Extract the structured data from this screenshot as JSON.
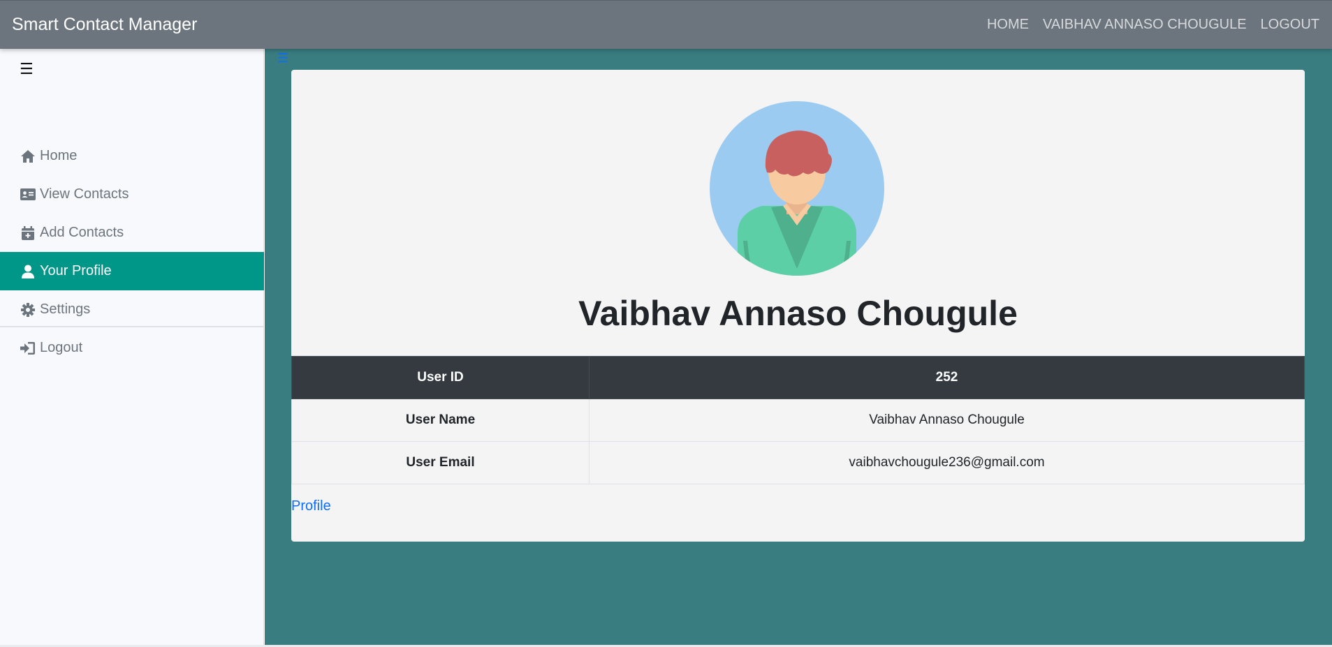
{
  "navbar": {
    "brand": "Smart Contact Manager",
    "links": [
      "HOME",
      "VAIBHAV ANNASO CHOUGULE",
      "LOGOUT"
    ]
  },
  "sidebar": {
    "menu_icon": "hamburger-menu-icon",
    "items": [
      {
        "label": "Home",
        "icon": "home-icon"
      },
      {
        "label": "View Contacts",
        "icon": "address-card-icon"
      },
      {
        "label": "Add Contacts",
        "icon": "calendar-plus-icon"
      },
      {
        "label": "Your Profile",
        "icon": "user-icon",
        "active": true
      },
      {
        "label": "Settings",
        "icon": "gear-icon"
      },
      {
        "label": "Logout",
        "icon": "sign-out-icon"
      }
    ]
  },
  "main": {
    "toggle_icon": "hamburger-menu-icon",
    "profile": {
      "avatar": "user-avatar-illustration",
      "name": "Vaibhav Annaso Chougule",
      "table": [
        {
          "label": "User ID",
          "value": "252"
        },
        {
          "label": "User Name",
          "value": "Vaibhav Annaso Chougule"
        },
        {
          "label": "User Email",
          "value": "vaibhavchougule236@gmail.com"
        }
      ],
      "link": "Profile"
    }
  },
  "colors": {
    "navbar": "#6c757d",
    "sidebar": "#f8f9fd",
    "active_item": "#009688",
    "main_background": "#397d80",
    "card": "#f4f4f4",
    "table_header": "#343a40",
    "link": "#0d6efd"
  }
}
